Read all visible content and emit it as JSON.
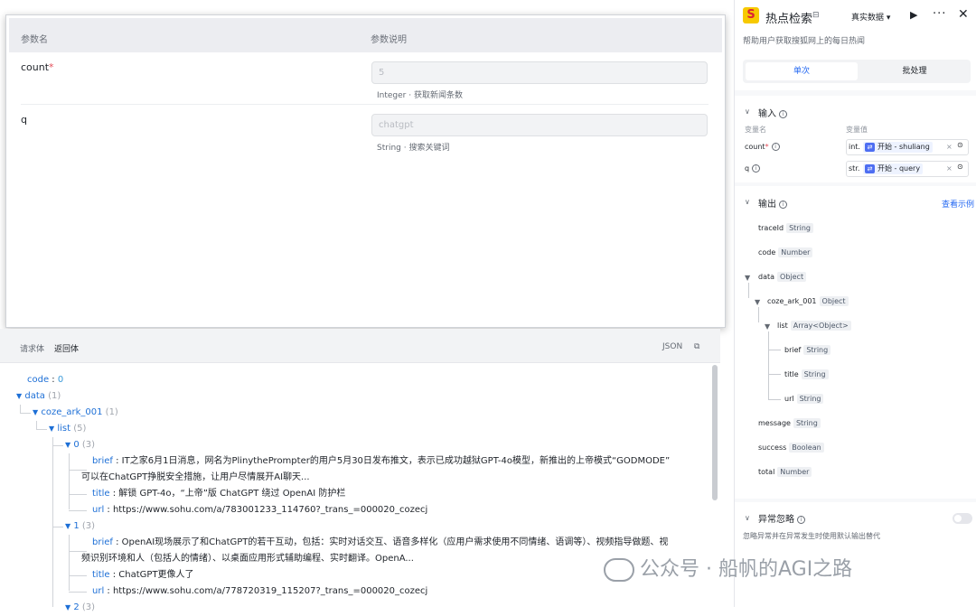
{
  "params_panel": {
    "col_name": "参数名",
    "col_desc": "参数说明",
    "rows": [
      {
        "name": "count",
        "required_mark": "*",
        "value": "5",
        "hint": "Integer · 获取新闻条数"
      },
      {
        "name": "q",
        "required_mark": "",
        "value": "chatgpt",
        "hint": "String · 搜索关键词"
      }
    ]
  },
  "bottom_tabs": {
    "request": "请求体",
    "response": "返回体",
    "json": "JSON"
  },
  "json_view": {
    "code_key": "code",
    "code_val": "0",
    "data_key": "data",
    "data_cnt": "(1)",
    "ark_key": "coze_ark_001",
    "ark_cnt": "(1)",
    "list_key": "list",
    "list_cnt": "(5)",
    "i0_key": "0",
    "i0_cnt": "(3)",
    "i0_brief_key": "brief",
    "i0_brief_1": "IT之家6月1日消息，网名为PlinythePrompter的用户5月30日发布推文，表示已成功越狱GPT-4o模型，新推出的上帝模式“GODMODE”",
    "i0_brief_2": "可以在ChatGPT挣脱安全措施，让用户尽情展开AI聊天...",
    "i0_title_key": "title",
    "i0_title": "解锁 GPT-4o，“上帝”版 ChatGPT 绕过 OpenAI 防护栏",
    "i0_url_key": "url",
    "i0_url": "https://www.sohu.com/a/783001233_114760?_trans_=000020_cozecj",
    "i1_key": "1",
    "i1_cnt": "(3)",
    "i1_brief_key": "brief",
    "i1_brief_1": "OpenAI现场展示了和ChatGPT的若干互动，包括：实时对话交互、语音多样化（应用户需求使用不同情绪、语调等）、视频指导做题、视",
    "i1_brief_2": "频识别环境和人（包括人的情绪）、以桌面应用形式辅助编程、实时翻译。OpenA...",
    "i1_title_key": "title",
    "i1_title": "ChatGPT更像人了",
    "i1_url_key": "url",
    "i1_url": "https://www.sohu.com/a/778720319_115207?_trans_=000020_cozecj",
    "i2_key": "2",
    "i2_cnt": "(3)",
    "sep": ":"
  },
  "right_panel": {
    "logo_char": "S",
    "title": "热点检索",
    "mode": "真实数据 ▾",
    "desc": "帮助用户获取搜狐网上的每日热闻",
    "tab_single": "单次",
    "tab_batch": "批处理",
    "input_title": "输入",
    "col_var_name": "变量名",
    "col_var_value": "变量值",
    "inputs": [
      {
        "name": "count",
        "req": "*",
        "type": "int.",
        "ref": "开始 - shuliang"
      },
      {
        "name": "q",
        "req": "",
        "type": "str.",
        "ref": "开始 - query"
      }
    ],
    "output_title": "输出",
    "view_example": "查看示例",
    "outputs": [
      {
        "name": "traceId",
        "type": "String"
      },
      {
        "name": "code",
        "type": "Number"
      },
      {
        "name": "data",
        "type": "Object"
      },
      {
        "name": "coze_ark_001",
        "type": "Object"
      },
      {
        "name": "list",
        "type": "Array<Object>"
      },
      {
        "name": "brief",
        "type": "String"
      },
      {
        "name": "title",
        "type": "String"
      },
      {
        "name": "url",
        "type": "String"
      },
      {
        "name": "message",
        "type": "String"
      },
      {
        "name": "success",
        "type": "Boolean"
      },
      {
        "name": "total",
        "type": "Number"
      }
    ],
    "exception_title": "异常忽略",
    "exception_desc": "忽略异常并在异常发生时使用默认输出替代",
    "exception_enabled": false
  },
  "watermark": "公众号 · 船帆的AGI之路",
  "colors": {
    "accent": "#2468f2",
    "key": "#1d6fd6",
    "logo": "#f7c900"
  }
}
